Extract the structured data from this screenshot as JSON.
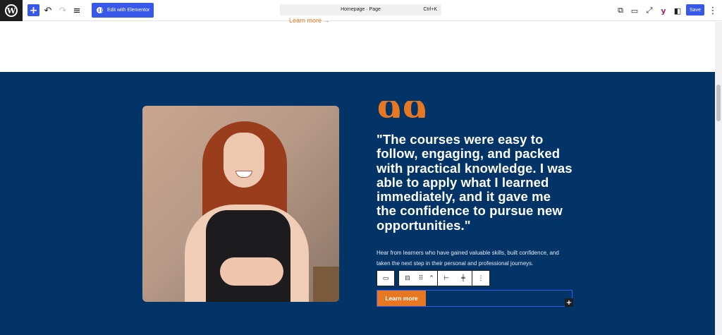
{
  "toolbar": {
    "wp_logo": "W",
    "add_icon": "+",
    "undo_icon": "↶",
    "redo_icon": "↷",
    "list_view_icon": "≡",
    "elementor_label": "Edit with Elementor",
    "document_title": "Homepage · Page",
    "shortcut": "Ctrl+K",
    "view_icon": "⧉",
    "device_icon": "▭",
    "fullscreen_icon": "⤢",
    "yoast_icon": "y",
    "settings_icon": "◧",
    "save_label": "Save",
    "options_icon": "⋮"
  },
  "content": {
    "top_link": "Learn more →",
    "quote_mark": "99",
    "quote": "\"The courses were easy to follow, engaging, and packed with practical knowledge. I was able to apply what I learned immediately, and it gave me the confidence to pursue new opportunities.\"",
    "subtext": "Hear from learners who have gained valuable skills, built confidence, and taken the next step in their personal and professional journeys.",
    "button_label": "Learn more"
  },
  "block_toolbar": {
    "block_icon": "▭",
    "buttons_icon": "⊟",
    "drag_icon": "⠿",
    "move_icon": "⌃",
    "justify_icon": "⊢",
    "align_icon": "╪",
    "more_icon": "⋮"
  },
  "add_block_icon": "+",
  "colors": {
    "accent": "#e87722",
    "section_bg": "#033467",
    "wp_blue": "#3858e9"
  }
}
